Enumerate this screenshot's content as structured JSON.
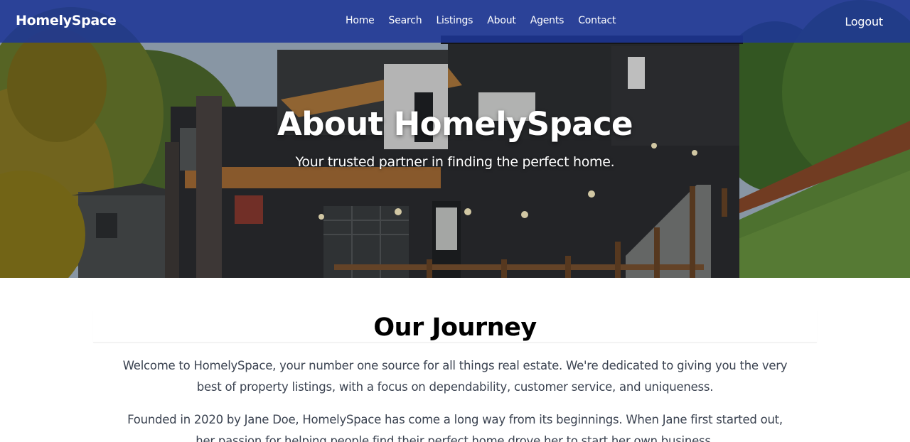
{
  "navbar": {
    "brand": "HomelySpace",
    "links": [
      {
        "label": "Home"
      },
      {
        "label": "Search"
      },
      {
        "label": "Listings"
      },
      {
        "label": "About"
      },
      {
        "label": "Agents"
      },
      {
        "label": "Contact"
      }
    ],
    "logout_label": "Logout",
    "background_color": "#1e3796"
  },
  "hero": {
    "title": "About HomelySpace",
    "subtitle": "Your trusted partner in finding the perfect home."
  },
  "journey": {
    "heading": "Our Journey",
    "paragraphs": [
      "Welcome to HomelySpace, your number one source for all things real estate. We're dedicated to giving you the very best of property listings, with a focus on dependability, customer service, and uniqueness.",
      "Founded in 2020 by Jane Doe, HomelySpace has come a long way from its beginnings. When Jane first started out, her passion for helping people find their perfect home drove her to start her own business."
    ]
  }
}
